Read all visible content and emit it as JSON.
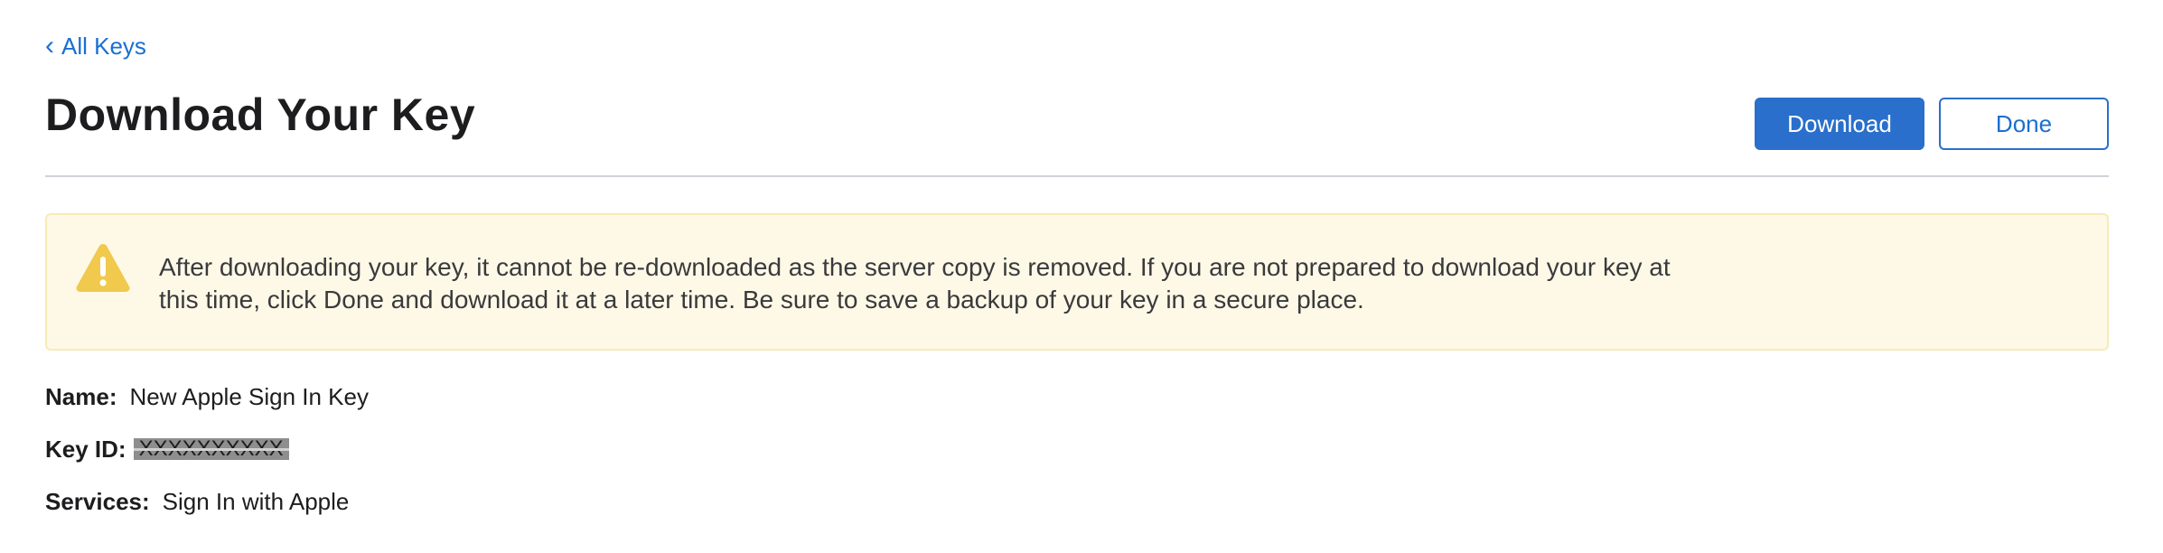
{
  "nav": {
    "back_label": "All Keys",
    "back_icon": "chevron-left-icon"
  },
  "header": {
    "title": "Download Your Key",
    "download_label": "Download",
    "done_label": "Done"
  },
  "warning": {
    "icon": "warning-triangle-icon",
    "message": "After downloading your key, it cannot be re-downloaded as the server copy is removed. If you are not prepared to download your key at this time, click Done and download it at a later time. Be sure to save a backup of your key in a secure place."
  },
  "details": {
    "name_label": "Name:",
    "name_value": "New Apple Sign In Key",
    "key_id_label": "Key ID:",
    "key_id_value": "XXXXXXXXXX",
    "services_label": "Services:",
    "services_value": "Sign In with Apple"
  },
  "colors": {
    "accent": "#2a6fcb",
    "link": "#1a6fd1",
    "warning_bg": "#fef9e7",
    "warning_icon": "#f0c94d"
  }
}
